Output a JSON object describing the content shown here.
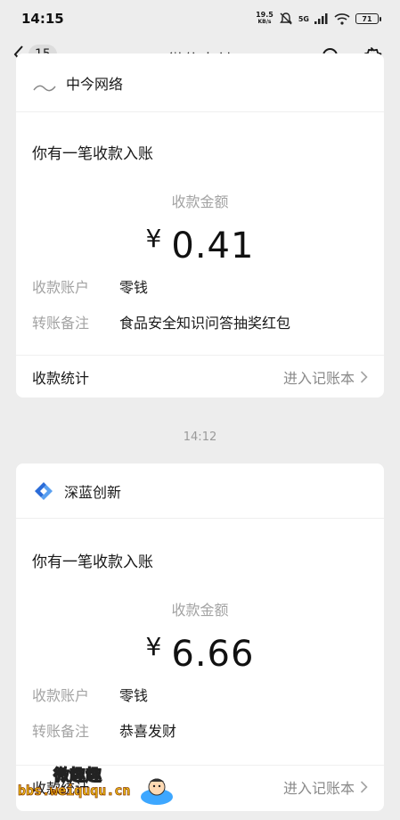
{
  "status_bar": {
    "time": "14:15",
    "net_speed_value": "19.5",
    "net_speed_unit": "KB/s",
    "signal_label": "5G",
    "battery": "71"
  },
  "nav": {
    "back_count": "15",
    "title": "微信支付"
  },
  "cards": [
    {
      "merchant": "中今网络",
      "title": "你有一笔收款入账",
      "amount_label": "收款金额",
      "currency": "¥",
      "amount": "0.41",
      "account_key": "收款账户",
      "account_val": "零钱",
      "note_key": "转账备注",
      "note_val": "食品安全知识问答抽奖红包",
      "footer_left": "收款统计",
      "footer_right": "进入记账本"
    },
    {
      "merchant": "深蓝创新",
      "title": "你有一笔收款入账",
      "amount_label": "收款金额",
      "currency": "¥",
      "amount": "6.66",
      "account_key": "收款账户",
      "account_val": "零钱",
      "note_key": "转账备注",
      "note_val": "恭喜发财",
      "footer_left": "收款统计",
      "footer_right": "进入记账本"
    }
  ],
  "timestamp": "14:12",
  "watermark": {
    "line1": "微趣趣",
    "line2": "bbs.weiququ.cn"
  }
}
